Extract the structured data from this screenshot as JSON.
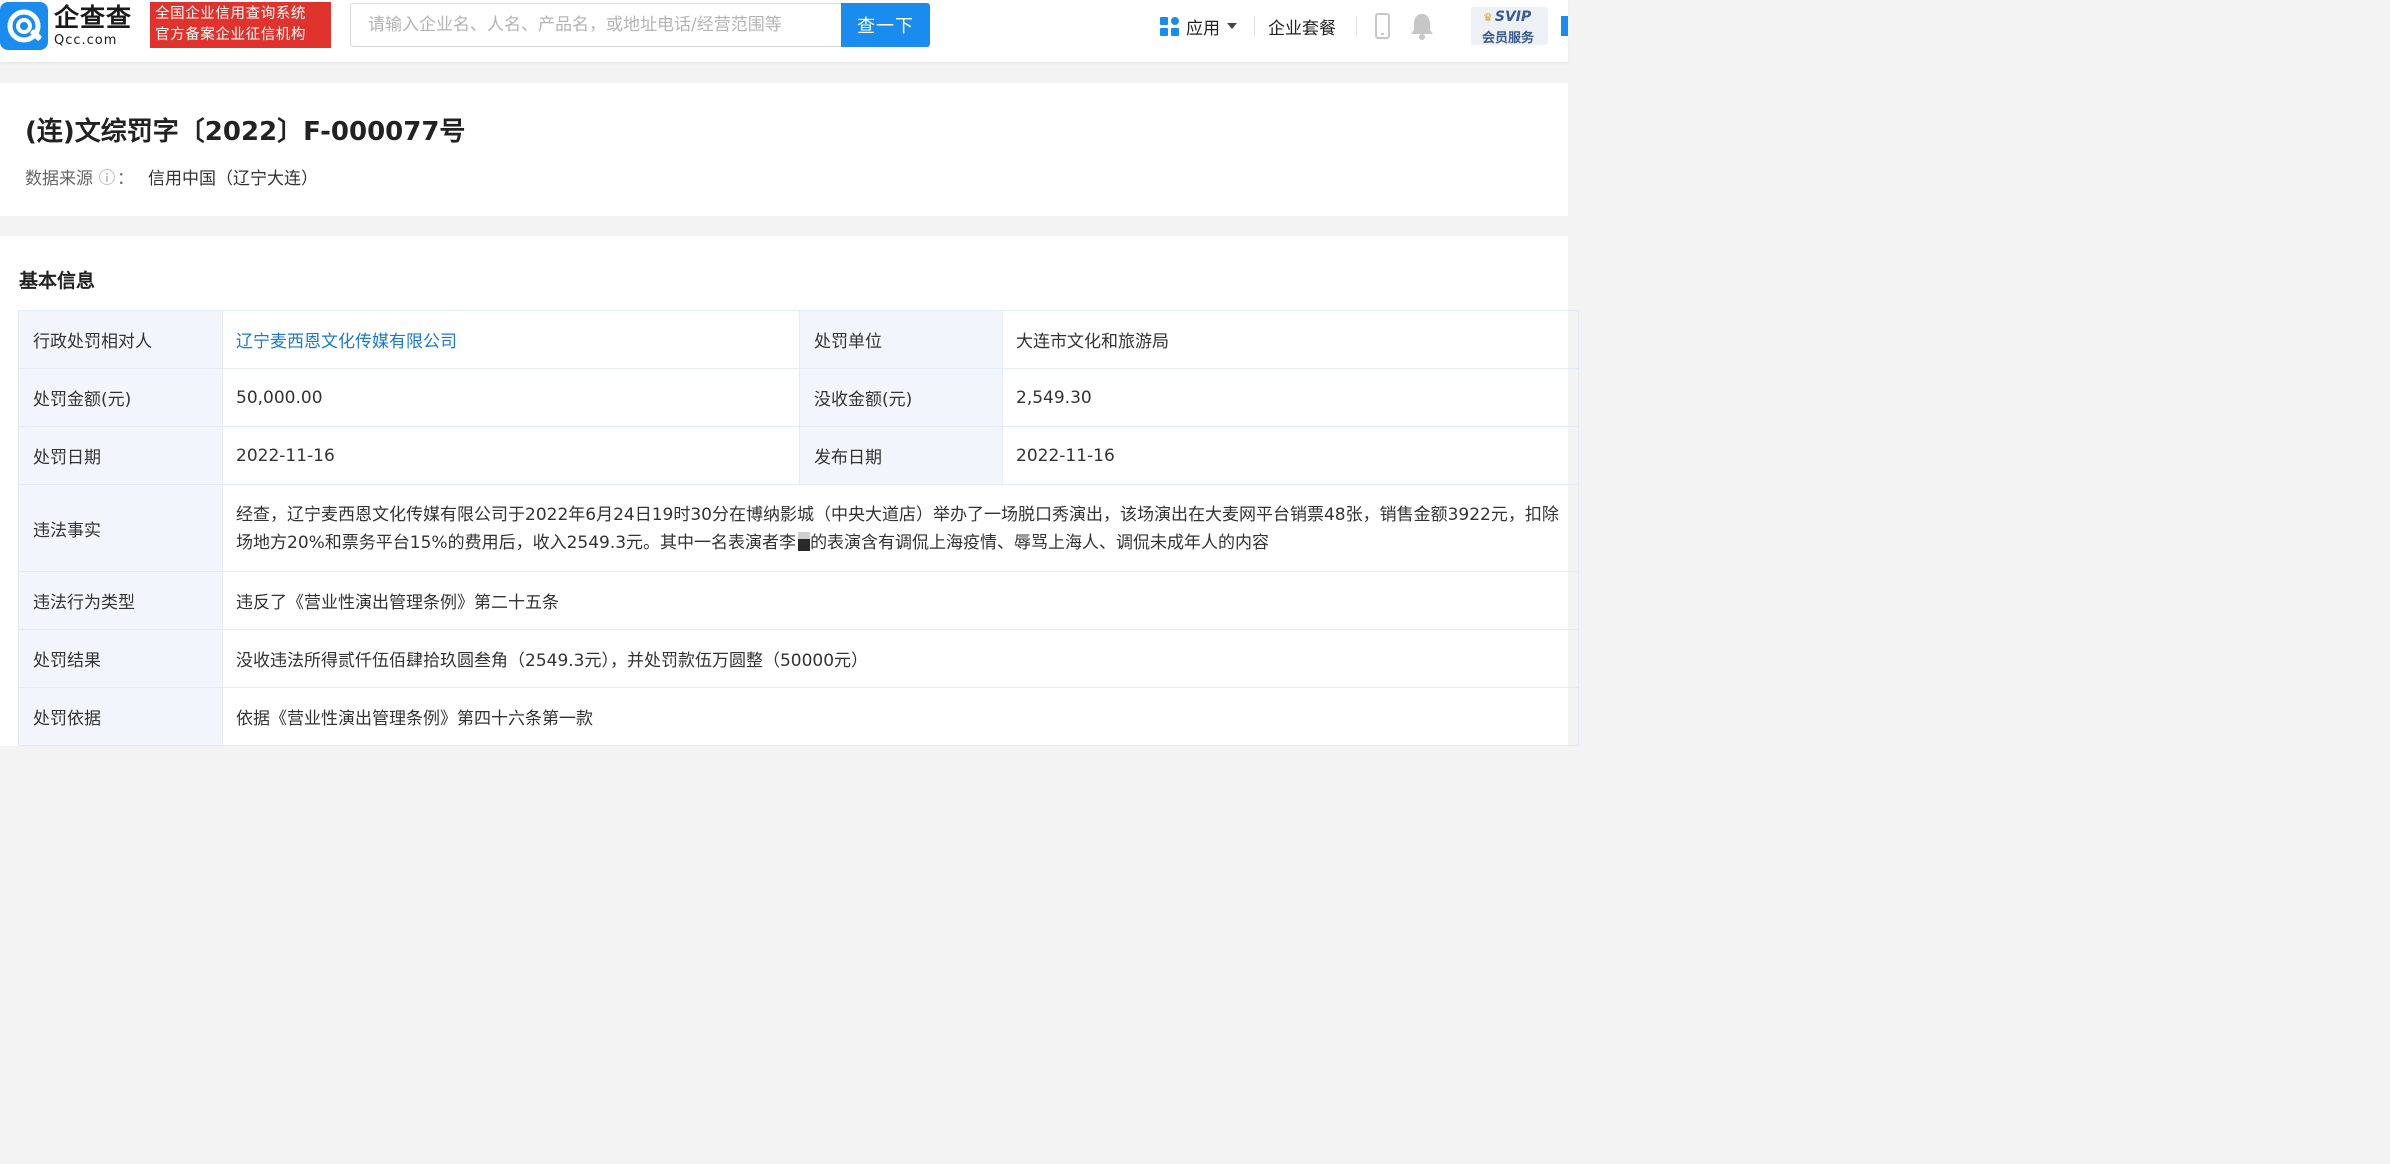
{
  "header": {
    "logo_cn": "企查查",
    "logo_en": "Qcc.com",
    "badge_line1": "全国企业信用查询系统",
    "badge_line2": "官方备案企业征信机构",
    "search_placeholder": "请输入企业名、人名、产品名，或地址电话/经营范围等",
    "search_button": "查一下",
    "apps_label": "应用",
    "package_label": "企业套餐",
    "svip_top": "SVIP",
    "svip_bottom": "会员服务"
  },
  "record": {
    "title": "(连)文综罚字〔2022〕F-000077号",
    "source_label": "数据来源",
    "source_colon": "：",
    "source_value": "信用中国（辽宁大连）"
  },
  "basic_info": {
    "section_title": "基本信息",
    "party_label": "行政处罚相对人",
    "party_value": "辽宁麦西恩文化传媒有限公司",
    "unit_label": "处罚单位",
    "unit_value": "大连市文化和旅游局",
    "amount_label": "处罚金额(元)",
    "amount_value": "50,000.00",
    "confiscated_label": "没收金额(元)",
    "confiscated_value": "2,549.30",
    "date_label": "处罚日期",
    "date_value": "2022-11-16",
    "publish_label": "发布日期",
    "publish_value": "2022-11-16",
    "facts_label": "违法事实",
    "facts_part1": "经查，辽宁麦西恩文化传媒有限公司于2022年6月24日19时30分在博纳影城（中央大道店）举办了一场脱口秀演出，该场演出在大麦网平台销票48张，销售金额3922元，扣除场地方20%和票务平台15%的费用后，收入2549.3元。其中一名表演者李",
    "facts_part2": "的表演含有调侃上海疫情、辱骂上海人、调侃未成年人的内容",
    "type_label": "违法行为类型",
    "type_value": "违反了《营业性演出管理条例》第二十五条",
    "result_label": "处罚结果",
    "result_value": "没收违法所得贰仟伍佰肆拾玖圆叁角（2549.3元），并处罚款伍万圆整（50000元）",
    "basis_label": "处罚依据",
    "basis_value": "依据《营业性演出管理条例》第四十六条第一款"
  },
  "colors": {
    "brand_blue": "#1a8cf0",
    "badge_red": "#e0332d",
    "link_blue": "#1a79d6",
    "label_bg": "#f2f6fc"
  },
  "icons": [
    "logo-icon",
    "apps-grid-icon",
    "chevron-down-icon",
    "phone-icon",
    "bell-icon",
    "crown-icon",
    "info-icon"
  ]
}
